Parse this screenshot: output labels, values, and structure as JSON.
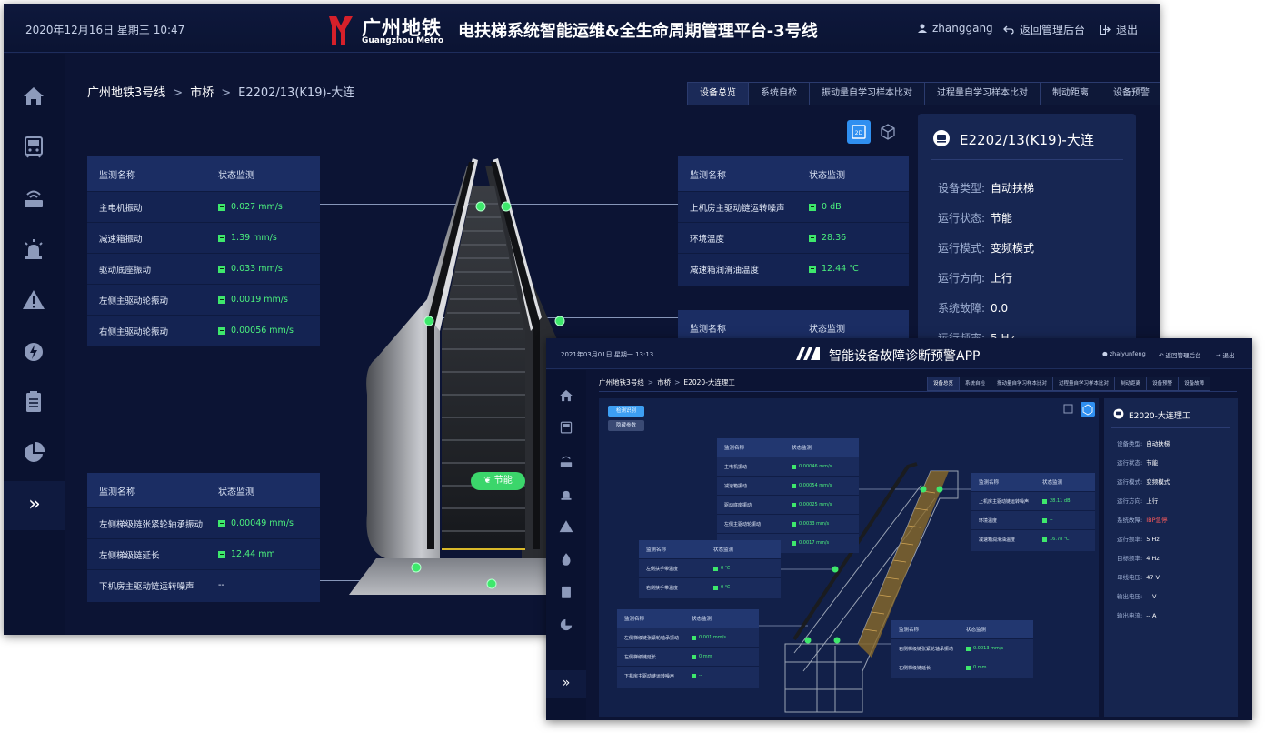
{
  "main": {
    "date": "2020年12月16日 星期三 10:47",
    "logo_cn": "广州地铁",
    "logo_en": "Guangzhou Metro",
    "title": "电扶梯系统智能运维&全生命周期管理平台-3号线",
    "user": "zhanggang",
    "back_label": "返回管理后台",
    "exit_label": "退出",
    "breadcrumb": [
      "广州地铁3号线",
      "市桥",
      "E2202/13(K19)-大连"
    ],
    "breadcrumb_sep": ">",
    "tabs": [
      "设备总览",
      "系统自检",
      "振动量自学习样本比对",
      "过程量自学习样本比对",
      "制动距离",
      "设备预警"
    ],
    "sidebar_icons": [
      "home-icon",
      "train-icon",
      "router-icon",
      "alarm-icon",
      "warning-icon",
      "fire-icon",
      "clipboard-icon",
      "pie-chart-icon"
    ],
    "sidebar_expand": "»",
    "table_left": {
      "headers": [
        "监测名称",
        "状态监测"
      ],
      "rows": [
        [
          "主电机振动",
          "0.027 mm/s"
        ],
        [
          "减速箱振动",
          "1.39 mm/s"
        ],
        [
          "驱动底座振动",
          "0.033 mm/s"
        ],
        [
          "左侧主驱动轮振动",
          "0.0019 mm/s"
        ],
        [
          "右侧主驱动轮振动",
          "0.00056 mm/s"
        ]
      ]
    },
    "table_right": {
      "headers": [
        "监测名称",
        "状态监测"
      ],
      "rows": [
        [
          "上机房主驱动链运转噪声",
          "0 dB"
        ],
        [
          "环境温度",
          "28.36"
        ],
        [
          "减速箱润滑油温度",
          "12.44 ℃"
        ]
      ]
    },
    "table_right2": {
      "headers": [
        "监测名称",
        "状态监测"
      ]
    },
    "table_bottom": {
      "headers": [
        "监测名称",
        "状态监测"
      ],
      "rows": [
        [
          "左侧梯级链张紧轮轴承振动",
          "0.00049 mm/s"
        ],
        [
          "左侧梯级链延长",
          "12.44 mm"
        ],
        [
          "下机房主驱动链运转噪声",
          "--"
        ]
      ]
    },
    "mode_badge": "节能",
    "device": {
      "title": "E2202/13(K19)-大连",
      "fields": [
        {
          "label": "设备类型:",
          "value": "自动扶梯"
        },
        {
          "label": "运行状态:",
          "value": "节能"
        },
        {
          "label": "运行模式:",
          "value": "变频模式"
        },
        {
          "label": "运行方向:",
          "value": "上行"
        },
        {
          "label": "系统故障:",
          "value": "0.0"
        },
        {
          "label": "运行频率:",
          "value": "5 Hz"
        }
      ]
    }
  },
  "app": {
    "date": "2021年03月01日 星期一 13:13",
    "title": "智能设备故障诊断预警APP",
    "user": "zhaiyunfeng",
    "back_label": "返回管理后台",
    "exit_label": "退出",
    "breadcrumb": [
      "广州地铁3号线",
      "市桥",
      "E2020-大连理工"
    ],
    "tabs": [
      "设备总览",
      "系统自检",
      "振动量自学习样本比对",
      "过程量自学习样本比对",
      "制动距离",
      "设备预警",
      "设备故障"
    ],
    "btn_primary": "检测识别",
    "btn_secondary": "隐藏参数",
    "table_a": {
      "headers": [
        "监测名称",
        "状态监测"
      ],
      "rows": [
        [
          "主电机振动",
          "0.00046 mm/s"
        ],
        [
          "减速箱振动",
          "0.00054 mm/s"
        ],
        [
          "驱动底座振动",
          "0.00025 mm/s"
        ],
        [
          "左侧主驱动轮振动",
          "0.0033 mm/s"
        ],
        [
          "",
          "0.0017 mm/s"
        ]
      ]
    },
    "table_b": {
      "headers": [
        "监测名称",
        "状态监测"
      ],
      "rows": [
        [
          "左侧扶手带温度",
          "0 ℃"
        ],
        [
          "右侧扶手带温度",
          "0 ℃"
        ]
      ]
    },
    "table_c": {
      "headers": [
        "监测名称",
        "状态监测"
      ],
      "rows": [
        [
          "左侧梯级链张紧轮轴承振动",
          "0.001 mm/s"
        ],
        [
          "左侧梯级链延长",
          "0 mm"
        ],
        [
          "下机房主驱动链运转噪声",
          "--"
        ]
      ]
    },
    "table_d": {
      "headers": [
        "监测名称",
        "状态监测"
      ],
      "rows": [
        [
          "上机房主驱动链运转噪声",
          "28.11 dB"
        ],
        [
          "环境温度",
          "--"
        ],
        [
          "减速箱润滑油温度",
          "16.78 ℃"
        ]
      ]
    },
    "table_e": {
      "headers": [
        "监测名称",
        "状态监测"
      ],
      "rows": [
        [
          "右侧梯级链张紧轮轴承振动",
          "0.0013 mm/s"
        ],
        [
          "右侧梯级链延长",
          "0 mm"
        ]
      ]
    },
    "device": {
      "title": "E2020-大连理工",
      "fields": [
        {
          "label": "设备类型:",
          "value": "自动扶梯"
        },
        {
          "label": "运行状态:",
          "value": "节能"
        },
        {
          "label": "运行模式:",
          "value": "变频模式"
        },
        {
          "label": "运行方向:",
          "value": "上行"
        },
        {
          "label": "系统故障:",
          "value": "IBP急停"
        },
        {
          "label": "运行频率:",
          "value": "5 Hz"
        },
        {
          "label": "目标频率:",
          "value": "4 Hz"
        },
        {
          "label": "母线电压:",
          "value": "47 V"
        },
        {
          "label": "输出电压:",
          "value": "-- V"
        },
        {
          "label": "输出电流:",
          "value": "-- A"
        }
      ]
    }
  },
  "colors": {
    "bg": "#0c1434",
    "panel": "#142352",
    "accent_blue": "#2f8ff0",
    "status_green": "#3ee86c",
    "alarm_red": "#ff5b5b"
  }
}
